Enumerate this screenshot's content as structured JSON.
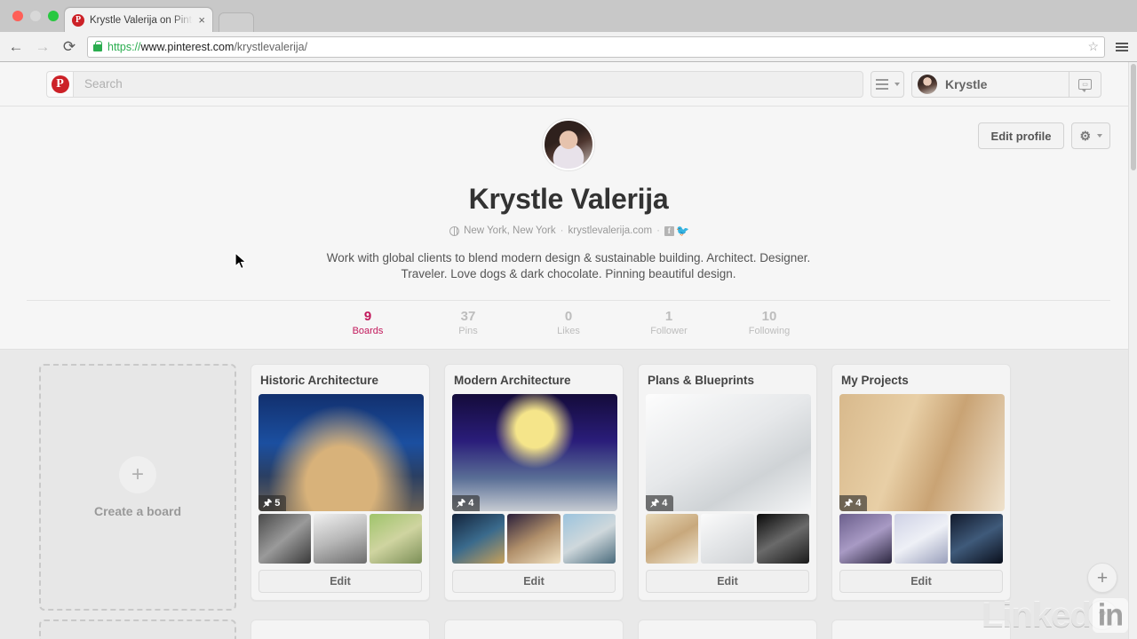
{
  "browser": {
    "tab": {
      "title": "Krystle Valerija on Pinteres",
      "close_label": "×",
      "favicon": "P"
    },
    "newtab_label": "",
    "nav": {
      "back": "←",
      "forward": "→",
      "reload": "⟳"
    },
    "url": {
      "scheme": "https://",
      "host": "www.pinterest.com",
      "path": "/krystlevalerija/"
    },
    "star_icon": "☆",
    "menu_icon": "hamburger-menu"
  },
  "header": {
    "logo": "P",
    "search_placeholder": "Search",
    "search_value": "",
    "user_name": "Krystle",
    "messages_icon": "message-bubble-icon"
  },
  "profile": {
    "name": "Krystle Valerija",
    "location": "New York, New York",
    "website": "krystlevalerija.com",
    "separator": "·",
    "facebook_icon": "f",
    "twitter_icon": "🐦",
    "bio_line1": "Work with global clients to blend modern design & sustainable building. Architect. Designer.",
    "bio_line2": "Traveler. Love dogs & dark chocolate. Pinning beautiful design.",
    "edit_profile_label": "Edit profile",
    "gear_icon": "⚙",
    "accent_color": "#c2185b",
    "stats": [
      {
        "num": "9",
        "label": "Boards",
        "active": true
      },
      {
        "num": "37",
        "label": "Pins",
        "active": false
      },
      {
        "num": "0",
        "label": "Likes",
        "active": false
      },
      {
        "num": "1",
        "label": "Follower",
        "active": false
      },
      {
        "num": "10",
        "label": "Following",
        "active": false
      }
    ]
  },
  "create_board": {
    "label": "Create a board",
    "plus_icon": "+"
  },
  "boards": [
    {
      "title": "Historic Architecture",
      "pin_count": "5",
      "edit_label": "Edit"
    },
    {
      "title": "Modern Architecture",
      "pin_count": "4",
      "edit_label": "Edit"
    },
    {
      "title": "Plans & Blueprints",
      "pin_count": "4",
      "edit_label": "Edit"
    },
    {
      "title": "My Projects",
      "pin_count": "4",
      "edit_label": "Edit"
    }
  ],
  "floating": {
    "add_icon": "+",
    "help_icon": "?"
  },
  "watermark": {
    "text": "Linked",
    "box": "in"
  }
}
